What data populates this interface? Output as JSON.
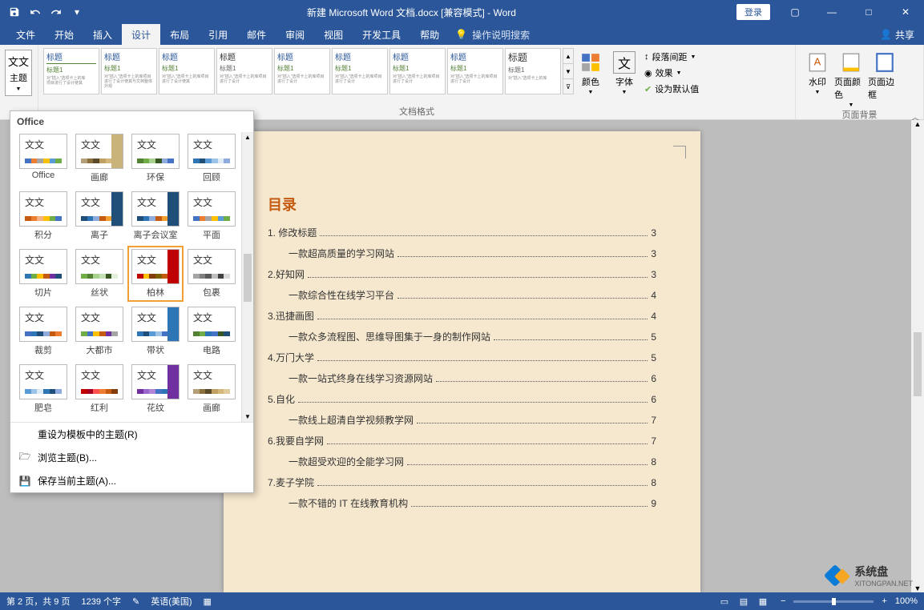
{
  "titlebar": {
    "title": "新建 Microsoft Word 文档.docx [兼容模式] - Word",
    "login": "登录"
  },
  "tabs": {
    "file": "文件",
    "home": "开始",
    "insert": "插入",
    "design": "设计",
    "layout": "布局",
    "references": "引用",
    "mailings": "邮件",
    "review": "审阅",
    "view": "视图",
    "developer": "开发工具",
    "help": "帮助",
    "tell_me": "操作说明搜索",
    "share": "共享"
  },
  "ribbon": {
    "themes_label": "主题",
    "doc_format_label": "文档格式",
    "sample_heading": "标题",
    "sample_sub": "标题1",
    "colors": "颜色",
    "fonts": "字体",
    "para_spacing": "段落间距",
    "effects": "效果",
    "set_default": "设为默认值",
    "watermark": "水印",
    "page_color": "页面颜色",
    "page_borders": "页面边框",
    "page_bg_label": "页面背景"
  },
  "themes_panel": {
    "header": "Office",
    "items": [
      "Office",
      "画廊",
      "环保",
      "回顾",
      "积分",
      "离子",
      "离子会议室",
      "平面",
      "切片",
      "丝状",
      "柏林",
      "包裹",
      "裁剪",
      "大都市",
      "带状",
      "电路",
      "肥皂",
      "红利",
      "花纹",
      "画廊"
    ],
    "reset": "重设为模板中的主题(R)",
    "browse": "浏览主题(B)...",
    "save": "保存当前主题(A)..."
  },
  "document": {
    "toc_title": "目录",
    "toc": [
      {
        "lvl": 1,
        "text": "1. 修改标题",
        "page": "3"
      },
      {
        "lvl": 2,
        "text": "一款超高质量的学习网站",
        "page": "3"
      },
      {
        "lvl": 1,
        "text": "2.好知网",
        "page": "3"
      },
      {
        "lvl": 2,
        "text": "一款综合性在线学习平台",
        "page": "4"
      },
      {
        "lvl": 1,
        "text": "3.迅捷画图",
        "page": "4"
      },
      {
        "lvl": 2,
        "text": "一款众多流程图、思维导图集于一身的制作网站",
        "page": "5"
      },
      {
        "lvl": 1,
        "text": "4.万门大学",
        "page": "5"
      },
      {
        "lvl": 2,
        "text": "一款一站式终身在线学习资源网站",
        "page": "6"
      },
      {
        "lvl": 1,
        "text": "5.自化",
        "page": "6"
      },
      {
        "lvl": 2,
        "text": "一款线上超清自学视频教学网",
        "page": "7"
      },
      {
        "lvl": 1,
        "text": "6.我要自学网",
        "page": "7"
      },
      {
        "lvl": 2,
        "text": "一款超受欢迎的全能学习网",
        "page": "8"
      },
      {
        "lvl": 1,
        "text": "7.麦子学院",
        "page": "8"
      },
      {
        "lvl": 2,
        "text": "一款不错的 IT 在线教育机构",
        "page": "9"
      }
    ]
  },
  "statusbar": {
    "page": "第 2 页，共 9 页",
    "words": "1239 个字",
    "lang": "英语(美国)",
    "zoom": "100%"
  },
  "watermark": {
    "name": "系统盘",
    "url": "XITONGPAN.NET"
  }
}
